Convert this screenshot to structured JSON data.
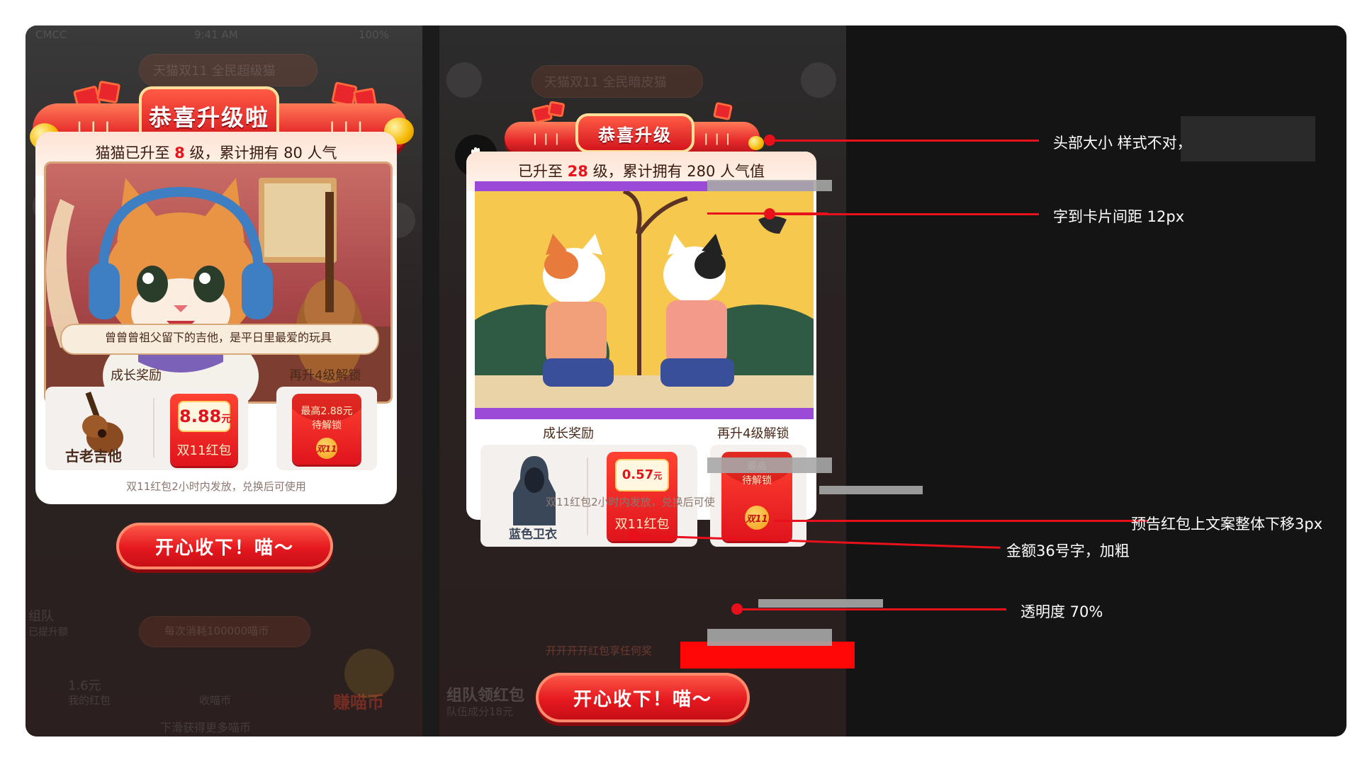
{
  "left": {
    "header_title": "恭喜升级啦",
    "level_line": {
      "prefix": "猫猫已升至 ",
      "level": "8",
      "middle": " 级，累计拥有 ",
      "points": "80",
      "suffix": " 人气"
    },
    "caption": "曾曾曾祖父留下的吉他，是平日里最爱的玩具",
    "growth_label": "成长奖励",
    "unlock_label": "再升4级解锁",
    "item_name": "古老吉他",
    "envelope_amount": "8.88",
    "envelope_unit": "元",
    "envelope_label": "双11红包",
    "preview_line1": "最高2.88元",
    "preview_line2": "待解锁",
    "seal_text": "双11",
    "footnote": "双11红包2小时内发放，兑换后可使用",
    "cta": "开心收下！喵～",
    "bg_texts": {
      "status": "CMCC",
      "time": "9:41 AM",
      "battery": "100%",
      "banner": "天猫双11 全民超级猫",
      "group": "组队",
      "sub": "已提升额",
      "consume": "每次消耗100000喵币",
      "amount": "1.6元",
      "my_envelope": "我的红包",
      "collect": "收喵币",
      "earn": "赚喵币",
      "scroll": "下滑获得更多喵币"
    }
  },
  "right": {
    "header_title": "恭喜升级",
    "level_line": {
      "prefix": "已升至 ",
      "level": "28",
      "middle": " 级，累计拥有 ",
      "points": "280",
      "suffix": " 人气值"
    },
    "growth_label": "成长奖励",
    "unlock_label": "再升4级解锁",
    "item_name": "蓝色卫衣",
    "envelope_amount": "0.57",
    "envelope_unit": "元",
    "envelope_label": "双11红包",
    "preview_line1": "最高",
    "preview_line2": "待解锁",
    "seal_text": "双11",
    "footnote": "双11红包2小时内发放，兑换后可使",
    "cta": "开心收下！喵～",
    "bg_texts": {
      "banner": "天猫双11 全民暗皮猫",
      "team": "组队领红包",
      "team_sub": "队伍成分18元",
      "redbar": "开开开开红包享任何奖"
    }
  },
  "annotations": [
    "头部大小 样式不对，",
    "字到卡片间距 12px",
    "预告红包上文案整体下移3px",
    "金额36号字，加粗",
    "透明度 70%"
  ],
  "colors": {
    "accent_red": "#e8101a",
    "annotation_bg": "#141414",
    "text_highlight": "#e8131c"
  }
}
